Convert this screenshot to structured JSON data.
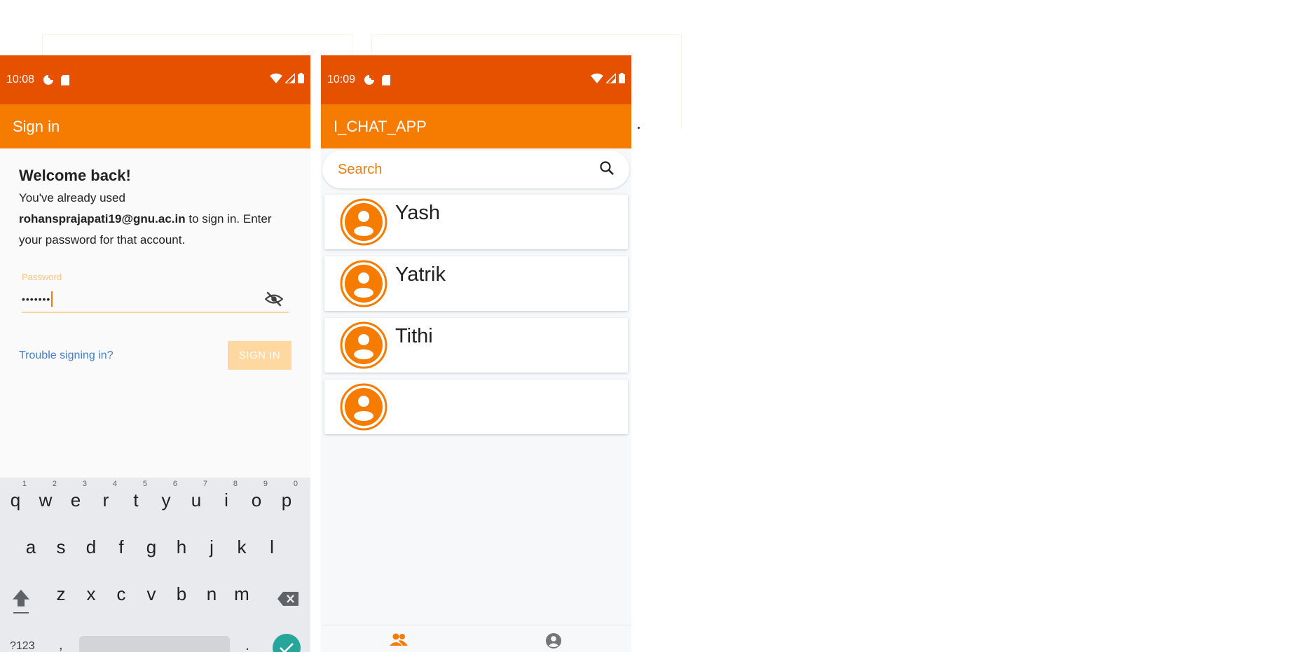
{
  "colors": {
    "status_bar": "#e65100",
    "app_bar": "#f57c00",
    "accent": "#f57c00",
    "link": "#3f7fcf",
    "enter_key": "#26a69a"
  },
  "signin_screen": {
    "status_bar": {
      "time": "10:08",
      "icons": [
        "data-saver-icon",
        "sd-card-icon",
        "wifi-icon",
        "signal-icon",
        "battery-icon"
      ]
    },
    "app_bar": {
      "title": "Sign in"
    },
    "welcome_title": "Welcome back!",
    "message": {
      "before": "You've already used ",
      "email": "rohansprajapati19@gnu.ac.in",
      "after": " to sign in. Enter your password for that account."
    },
    "password": {
      "label": "Password",
      "value": "•••••••"
    },
    "trouble_link": "Trouble signing in?",
    "signin_button": "SIGN IN",
    "keyboard": {
      "row1": [
        {
          "num": "1",
          "ch": "q"
        },
        {
          "num": "2",
          "ch": "w"
        },
        {
          "num": "3",
          "ch": "e"
        },
        {
          "num": "4",
          "ch": "r"
        },
        {
          "num": "5",
          "ch": "t"
        },
        {
          "num": "6",
          "ch": "y"
        },
        {
          "num": "7",
          "ch": "u"
        },
        {
          "num": "8",
          "ch": "i"
        },
        {
          "num": "9",
          "ch": "o"
        },
        {
          "num": "0",
          "ch": "p"
        }
      ],
      "row2": [
        "a",
        "s",
        "d",
        "f",
        "g",
        "h",
        "j",
        "k",
        "l"
      ],
      "row3": [
        "z",
        "x",
        "c",
        "v",
        "b",
        "n",
        "m"
      ],
      "symbols_key": "?123",
      "comma": ",",
      "period": "."
    }
  },
  "chat_screen": {
    "status_bar": {
      "time": "10:09",
      "icons": [
        "data-saver-icon",
        "sd-card-icon",
        "wifi-icon",
        "signal-icon",
        "battery-icon"
      ]
    },
    "app_bar": {
      "title": "I_CHAT_APP"
    },
    "search": {
      "placeholder": "Search",
      "icon": "search-icon"
    },
    "contacts": [
      "Yash",
      "Yatrik",
      "Tithi",
      ""
    ],
    "bottom_nav": [
      "people-icon",
      "account-circle-icon"
    ]
  }
}
